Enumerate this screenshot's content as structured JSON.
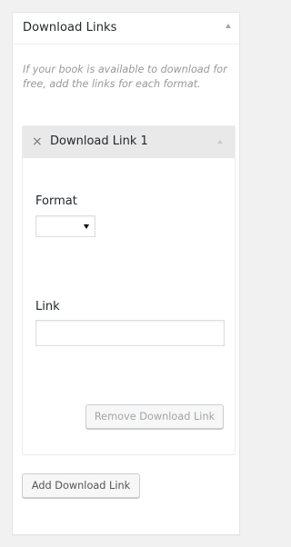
{
  "metabox": {
    "title": "Download Links",
    "description": "If your book is available to download for free, add the links for each format."
  },
  "group": {
    "remove_glyph": "×",
    "title": "Download Link 1",
    "format_label": "Format",
    "format_selected": "",
    "link_label": "Link",
    "link_value": "",
    "remove_button": "Remove Download Link"
  },
  "add_button": "Add Download Link",
  "colors": {
    "background": "#f1f1f1",
    "panel": "#ffffff",
    "group_header": "#e9e9e9",
    "description_text": "#999999",
    "disabled_button_text": "#a0a5aa"
  },
  "icons": {
    "metabox_toggle": "caret-up-icon",
    "group_toggle": "caret-up-icon",
    "remove": "close-icon",
    "select_arrow": "caret-down-icon"
  }
}
